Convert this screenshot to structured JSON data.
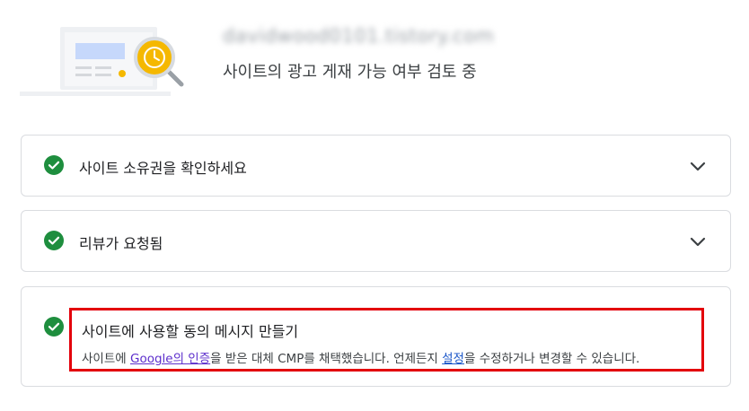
{
  "header": {
    "site_name": "davidwood0101.tistory.com",
    "status": "사이트의 광고 게재 가능 여부 검토 중"
  },
  "cards": [
    {
      "title": "사이트 소유권을 확인하세요",
      "icon": "check-circle-icon",
      "expand_icon": "chevron-down-icon"
    },
    {
      "title": "리뷰가 요청됨",
      "icon": "check-circle-icon",
      "expand_icon": "chevron-down-icon"
    },
    {
      "title": "사이트에 사용할 동의 메시지 만들기",
      "icon": "check-circle-icon",
      "desc_part1": "사이트에 ",
      "desc_link1": "Google의 인증",
      "desc_part2": "을 받은 대체 CMP를 채택했습니다. 언제든지 ",
      "desc_link2": "설정",
      "desc_part3": "을 수정하거나 변경할 수 있습니다."
    }
  ],
  "colors": {
    "check_green": "#1e8e3e",
    "highlight_red": "#e3000b",
    "link_purple": "#5c2ecc",
    "link_blue": "#1a56c8",
    "clock_yellow": "#f5b800"
  }
}
